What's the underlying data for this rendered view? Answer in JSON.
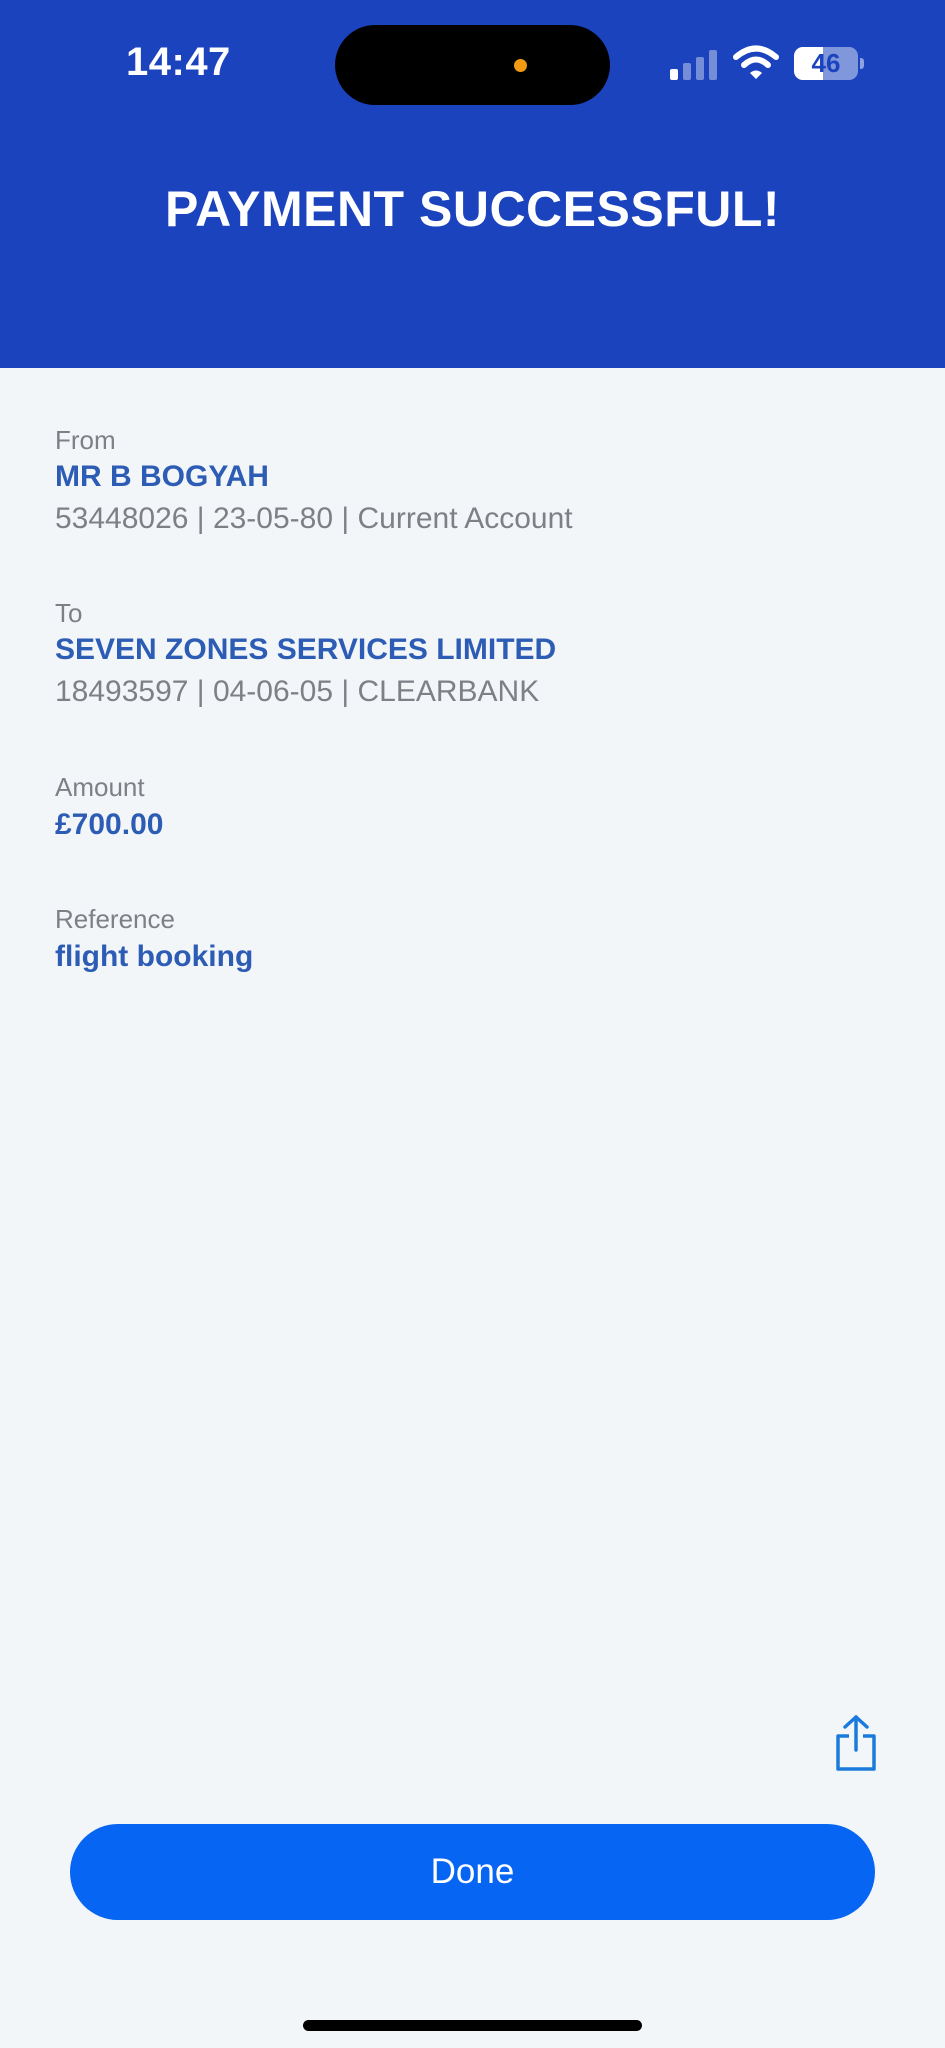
{
  "status_bar": {
    "time": "14:47",
    "battery": "46",
    "battery_level": 0.46,
    "signal_bars_active": 1,
    "signal_bars_total": 4
  },
  "header": {
    "title": "PAYMENT SUCCESSFUL!"
  },
  "details": {
    "from": {
      "label": "From",
      "name": "MR B BOGYAH",
      "detail": "53448026 | 23-05-80 | Current Account"
    },
    "to": {
      "label": "To",
      "name": "SEVEN ZONES SERVICES LIMITED",
      "detail": "18493597 | 04-06-05 | CLEARBANK"
    },
    "amount": {
      "label": "Amount",
      "value": "£700.00"
    },
    "reference": {
      "label": "Reference",
      "value": "flight booking"
    }
  },
  "actions": {
    "share_icon": "share-icon",
    "done_label": "Done"
  },
  "colors": {
    "header_bg": "#1b43bd",
    "page_bg": "#f3f6f9",
    "value_text": "#2d5cb5",
    "label_text": "#7d8087",
    "button_bg": "#0765f4",
    "share_icon": "#1a7bdc"
  }
}
